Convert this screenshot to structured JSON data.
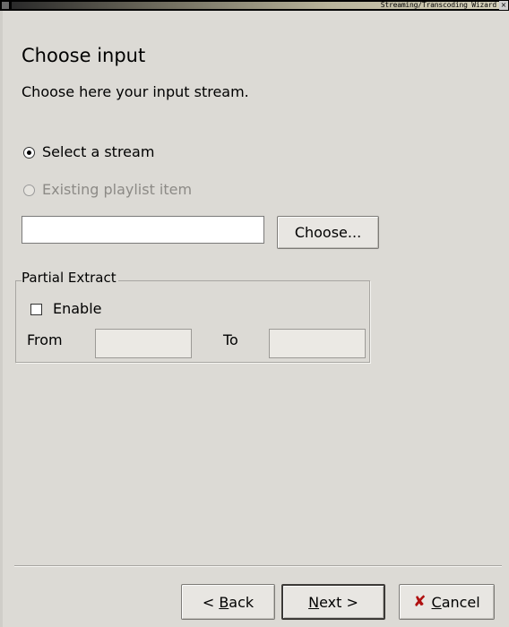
{
  "window": {
    "title": "Streaming/Transcoding Wizard",
    "close_glyph": "×"
  },
  "page": {
    "title": "Choose input",
    "subtitle": "Choose here your input stream."
  },
  "input_source": {
    "select_stream_label": "Select a stream",
    "select_stream_checked": true,
    "playlist_item_label": "Existing playlist item",
    "playlist_item_enabled": false,
    "stream_value": "",
    "choose_button_label": "Choose..."
  },
  "partial_extract": {
    "legend": "Partial Extract",
    "enable_label": "Enable",
    "enable_checked": false,
    "from_label": "From",
    "from_value": "",
    "to_label": "To",
    "to_value": ""
  },
  "footer": {
    "back_label_prefix": "< ",
    "back_label_accel": "B",
    "back_label_rest": "ack",
    "next_label_accel": "N",
    "next_label_rest": "ext >",
    "cancel_glyph": "✘",
    "cancel_label_accel": "C",
    "cancel_label_rest": "ancel"
  },
  "icons": {
    "window_menu": "window-menu-icon",
    "close": "close-icon",
    "cancel": "cancel-x-icon"
  },
  "colors": {
    "background": "#dcdad5",
    "titlebar": "#000000",
    "cancel_accent": "#b01010"
  }
}
